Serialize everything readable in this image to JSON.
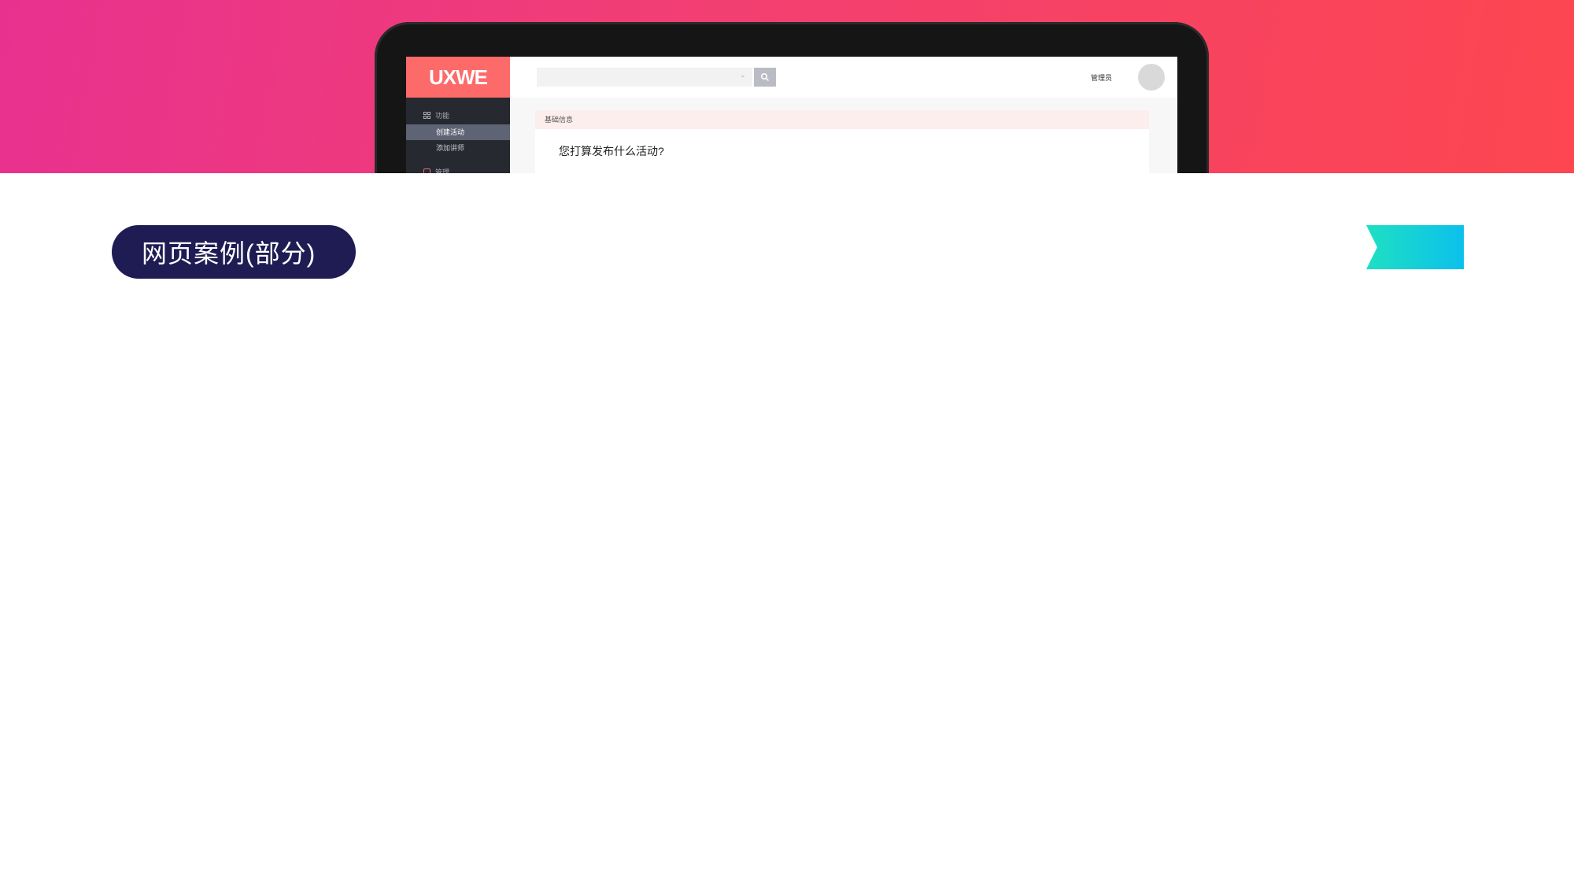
{
  "app": {
    "logo": "UXWE",
    "sidebar": {
      "group_label": "功能",
      "items": [
        {
          "label": "创建活动",
          "active": true
        },
        {
          "label": "添加讲师",
          "active": false
        }
      ],
      "more_label": "管理"
    },
    "search": {
      "placeholder": "",
      "button_icon": "search-icon"
    },
    "header": {
      "user_label": "管理员"
    },
    "content": {
      "section_title": "基础信息",
      "question": "您打算发布什么活动?"
    }
  },
  "banner": {
    "title": "网页案例(部分)"
  },
  "colors": {
    "hero_gradient": [
      "#e8318f",
      "#fd4650"
    ],
    "logo_bg": "#fd6a6a",
    "sidebar_bg": "#26292f",
    "active_item_bg": "#5f6474",
    "pill_bg": "#1f1c54",
    "ribbon_gradient": [
      "#1ee0c2",
      "#0cc0ec"
    ]
  }
}
